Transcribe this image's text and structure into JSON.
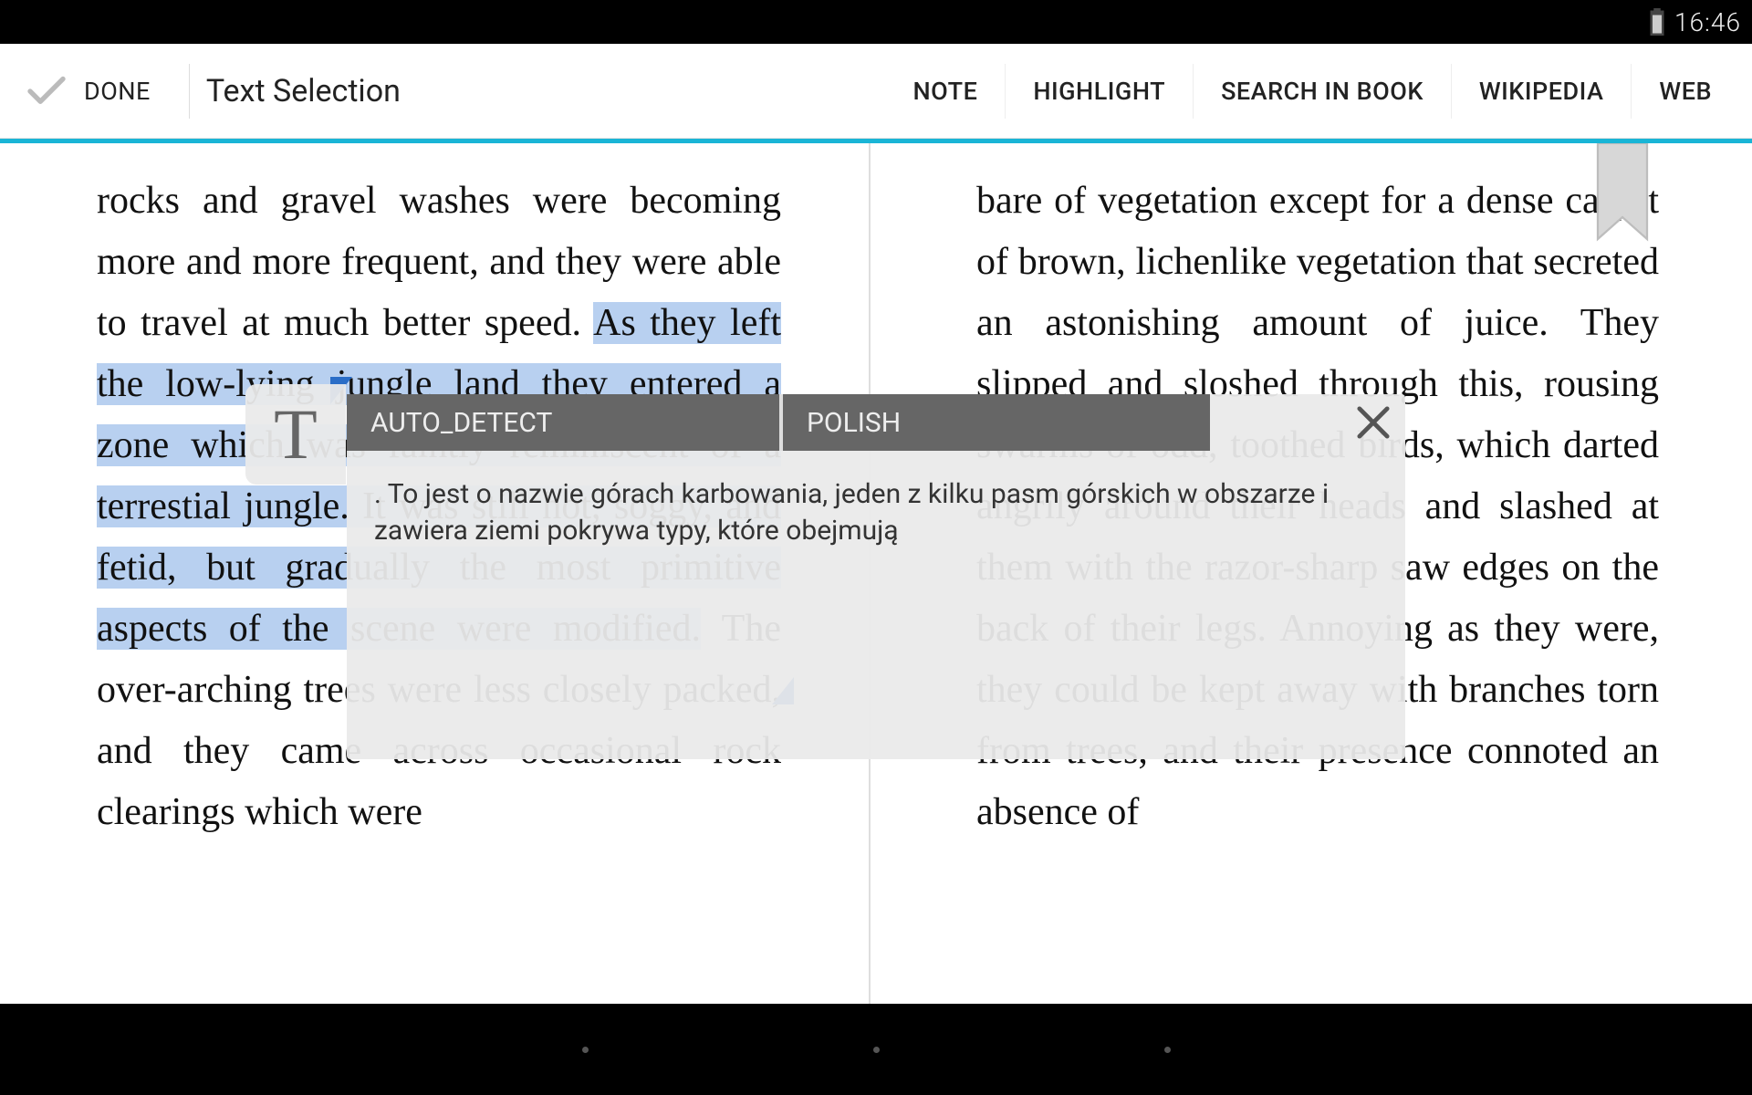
{
  "status_bar": {
    "time": "16:46"
  },
  "toolbar": {
    "done_label": "DONE",
    "title": "Text Selection",
    "actions": {
      "note": "NOTE",
      "highlight": "HIGHLIGHT",
      "search": "SEARCH IN BOOK",
      "wikipedia": "WIKIPEDIA",
      "web": "WEB"
    }
  },
  "page_left": {
    "pre": "rocks and gravel washes were becoming more and more frequent, and they were able to travel at much better speed. ",
    "highlighted": "As they left the low-lying jungle land they entered a zone which was faintly reminiscent of a terrestial jungle. It was still hot, soggy, and fetid, but gradually the most primitive aspects of the scene were modified.",
    "post": " The over-arching trees were less closely packed, and they came across occasional rock clearings which were"
  },
  "page_right": {
    "text": "bare of vegetation except for a dense carpet of brown, lichenlike vegetation that secreted an astonishing amount of juice. They slipped and sloshed through this, rousing swarms of odd, toothed birds, which darted angrily around their heads and slashed at them with the razor-sharp saw edges on the back of their legs. Annoying as they were, they could be kept away with branches torn from trees, and their presence connoted an absence of"
  },
  "popup": {
    "icon_glyph": "T",
    "tab_active": "AUTO_DETECT",
    "tab_inactive": "POLISH",
    "translation": ". To jest o nazwie górach karbowania, jeden z kilku pasm górskich w obszarze i zawiera ziemi pokrywa typy, które obejmują"
  }
}
